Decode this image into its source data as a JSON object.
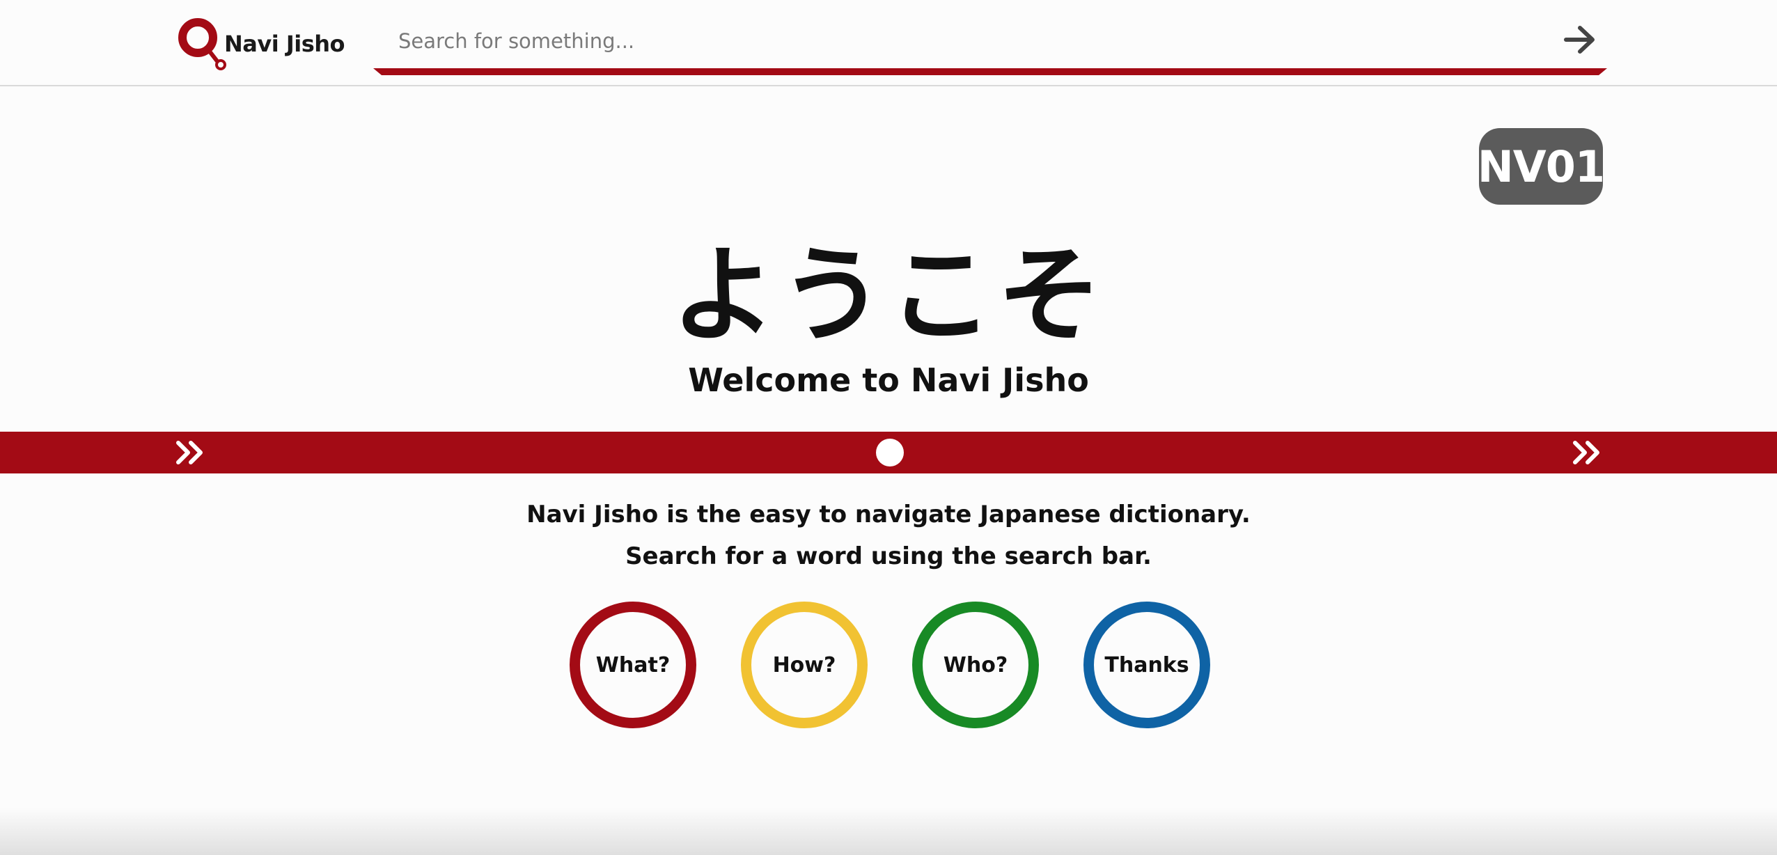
{
  "header": {
    "app_name": "Navi Jisho",
    "search": {
      "placeholder": "Search for something...",
      "value": ""
    }
  },
  "station_badge": "NV01",
  "hero": {
    "japanese": "ようこそ",
    "english": "Welcome to Navi Jisho"
  },
  "description": [
    "Navi Jisho is the easy to navigate Japanese dictionary.",
    "Search for a word using the search bar."
  ],
  "circles": [
    {
      "label": "What?",
      "color": "#a30b15"
    },
    {
      "label": "How?",
      "color": "#f1c232"
    },
    {
      "label": "Who?",
      "color": "#188a25"
    },
    {
      "label": "Thanks",
      "color": "#0f63a5"
    }
  ],
  "colors": {
    "accent": "#a30b15",
    "badge_bg": "#5b5b5b",
    "background": "#fcfcfc"
  },
  "icons": {
    "logo": "magnifier-logo-icon",
    "submit": "arrow-right-icon",
    "track_left": "double-chevron-right-icon",
    "track_right": "double-chevron-right-icon"
  }
}
